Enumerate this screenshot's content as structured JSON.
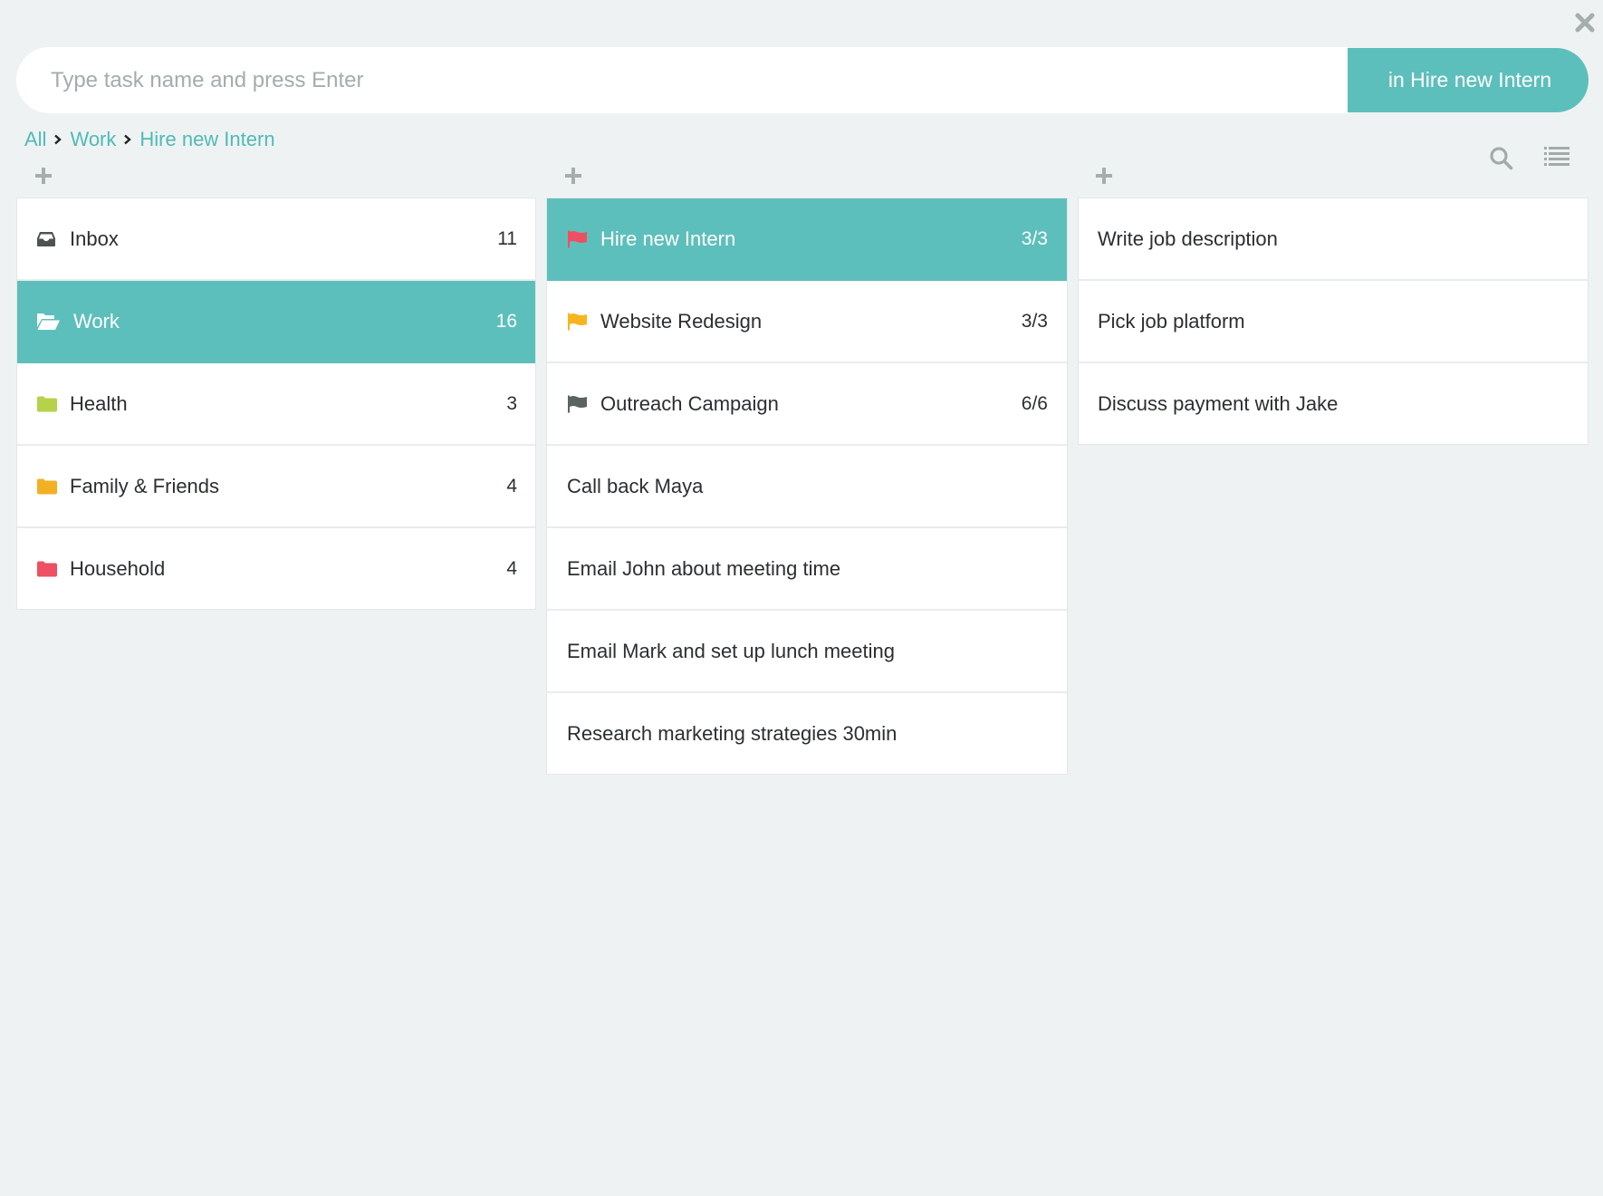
{
  "window": {
    "close_label": "Close"
  },
  "entry": {
    "placeholder": "Type task name and press Enter",
    "value": "",
    "target_button": "in Hire new Intern"
  },
  "breadcrumb": [
    {
      "label": "All"
    },
    {
      "label": "Work"
    },
    {
      "label": "Hire new Intern"
    }
  ],
  "toolbar": {
    "search_icon": "search-icon",
    "view_icon": "list-view-icon"
  },
  "colors": {
    "accent": "#5dbfbc",
    "link": "#4fbab6",
    "background": "#eff2f3",
    "icon_gray": "#a6adad",
    "health": "#b5d24a",
    "family": "#f2b024",
    "household": "#ee4f62",
    "flag_red": "#ef4f62",
    "flag_yellow": "#f6b51f",
    "flag_gray": "#5b6262"
  },
  "lists": [
    {
      "label": "Inbox",
      "count": "11",
      "icon": "inbox-icon",
      "selected": false
    },
    {
      "label": "Work",
      "count": "16",
      "icon": "folder-open-icon",
      "selected": true
    },
    {
      "label": "Health",
      "count": "3",
      "icon": "folder-icon",
      "color": "#b5d24a",
      "selected": false
    },
    {
      "label": "Family & Friends",
      "count": "4",
      "icon": "folder-icon",
      "color": "#f2b024",
      "selected": false
    },
    {
      "label": "Household",
      "count": "4",
      "icon": "folder-icon",
      "color": "#ee4f62",
      "selected": false
    }
  ],
  "projects": [
    {
      "label": "Hire new Intern",
      "count": "3/3",
      "icon": "flag-icon",
      "flag_color": "#ef4f62",
      "selected": true
    },
    {
      "label": "Website Redesign",
      "count": "3/3",
      "icon": "flag-icon",
      "flag_color": "#f6b51f",
      "selected": false
    },
    {
      "label": "Outreach Campaign",
      "count": "6/6",
      "icon": "flag-icon",
      "flag_color": "#5b6262",
      "selected": false
    },
    {
      "label": "Call back Maya"
    },
    {
      "label": "Email John about meeting time"
    },
    {
      "label": "Email Mark and set up lunch meeting"
    },
    {
      "label": "Research marketing strategies 30min"
    }
  ],
  "tasks": [
    {
      "label": "Write job description"
    },
    {
      "label": "Pick job platform"
    },
    {
      "label": "Discuss payment with Jake"
    }
  ]
}
